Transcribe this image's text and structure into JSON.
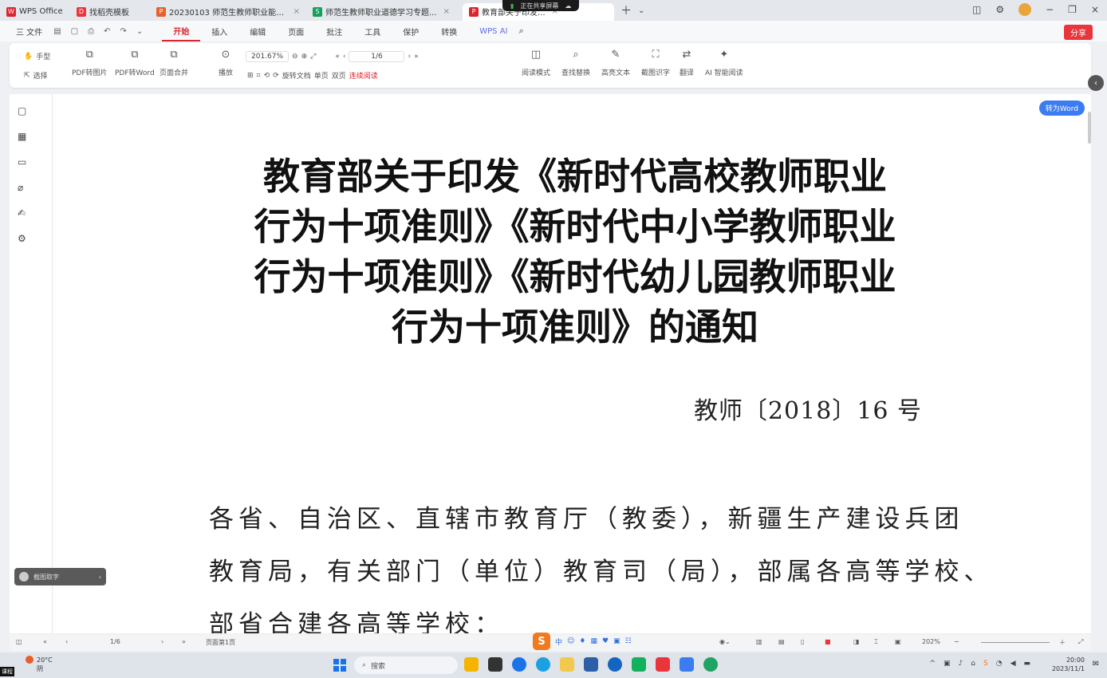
{
  "tabs": [
    {
      "label": "WPS Office",
      "color": "#d9262e",
      "active": false
    },
    {
      "label": "找稻壳模板",
      "color": "#e8363c",
      "active": false
    },
    {
      "label": "20230103 师范生教师职业能力训练...",
      "color": "#e8612c",
      "active": false
    },
    {
      "label": "师范生教师职业道德学习专题...",
      "color": "#15a05c",
      "active": false
    },
    {
      "label": "教育部关于印发...",
      "color": "#d9262e",
      "active": true
    }
  ],
  "recording": {
    "label": "正在共享屏幕"
  },
  "menu": {
    "file": "三 文件",
    "items": [
      "开始",
      "插入",
      "编辑",
      "页面",
      "批注",
      "工具",
      "保护",
      "转换",
      "WPS AI"
    ],
    "active": "开始",
    "share": "分享"
  },
  "toolbar": {
    "hand": "手型",
    "select": "选择",
    "pdf_to_image": "PDF转图片",
    "pdf_to_word": "PDF转Word",
    "page_merge": "页面合并",
    "play": "播放",
    "zoom": "201.67%",
    "page": "1/6",
    "rotate": "旋转文档",
    "single": "单页",
    "double": "双页",
    "continuous": "连续阅读",
    "read_mode": "阅读模式",
    "find": "查找替换",
    "highlight": "高亮文本",
    "annotate": "截图识字",
    "translate": "翻译",
    "ai_read": "AI 智能阅读"
  },
  "rail_icons": [
    "bookmark-icon",
    "thumbnail-icon",
    "comment-icon",
    "attachment-icon",
    "signature-icon",
    "settings-icon"
  ],
  "document": {
    "title_lines": [
      "教育部关于印发《新时代高校教师职业",
      "行为十项准则》《新时代中小学教师职业",
      "行为十项准则》《新时代幼儿园教师职业",
      "行为十项准则》的通知"
    ],
    "doc_number": "教师〔2018〕16 号",
    "body_lines": [
      "各省、自治区、直辖市教育厅（教委），新疆生产建设兵团",
      "教育局，有关部门（单位）教育司（局），部属各高等学校、",
      "部省合建各高等学校："
    ]
  },
  "to_word": "转为Word",
  "float_pill": "截图取字",
  "statusbar": {
    "page": "1/6",
    "page_label": "页面第1页",
    "zoom": "202%"
  },
  "ime": {
    "logo": "S"
  },
  "taskbar": {
    "weather_temp": "20°C",
    "weather_desc": "阴",
    "search": "搜索",
    "time": "20:00",
    "date": "2023/11/1"
  },
  "corner_tag": "课程"
}
